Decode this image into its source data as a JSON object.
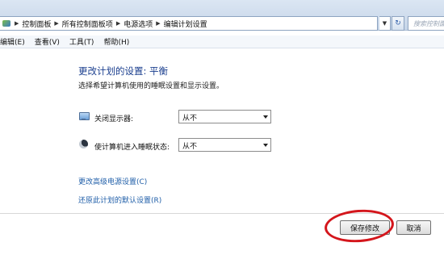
{
  "address_bar": {
    "breadcrumbs": [
      "控制面板",
      "所有控制面板项",
      "电源选项",
      "编辑计划设置"
    ],
    "search_placeholder": "搜索控制面"
  },
  "menu": {
    "items": [
      "编辑(E)",
      "查看(V)",
      "工具(T)",
      "帮助(H)"
    ]
  },
  "plan": {
    "title": "更改计划的设置: 平衡",
    "subtitle": "选择希望计算机使用的睡眠设置和显示设置。"
  },
  "settings": [
    {
      "label": "关闭显示器:",
      "value": "从不",
      "icon": "monitor-icon"
    },
    {
      "label": "使计算机进入睡眠状态:",
      "value": "从不",
      "icon": "sleep-moon-icon"
    }
  ],
  "links": {
    "advanced": "更改高级电源设置(C)",
    "restore": "还原此计划的默认设置(R)"
  },
  "buttons": {
    "save": "保存修改",
    "cancel": "取消"
  },
  "colors": {
    "title": "#1b3f8f",
    "link": "#1f5ea8",
    "highlight": "#d4161c"
  }
}
